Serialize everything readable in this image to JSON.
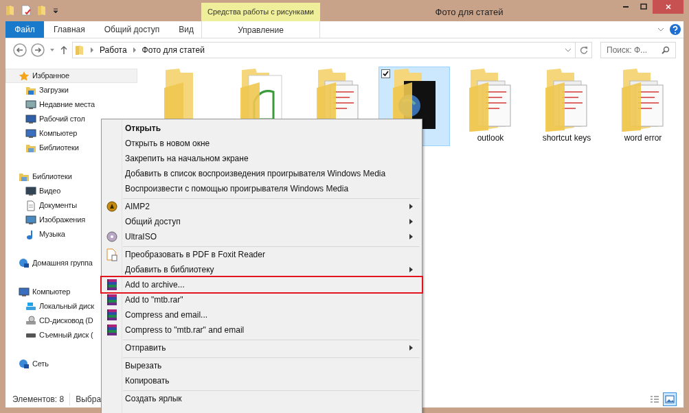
{
  "window": {
    "title": "Фото для статей",
    "context_tab": "Средства работы с рисунками"
  },
  "ribbon_tabs": [
    {
      "label": "Файл",
      "kind": "file"
    },
    {
      "label": "Главная",
      "kind": "tab"
    },
    {
      "label": "Общий доступ",
      "kind": "tab"
    },
    {
      "label": "Вид",
      "kind": "tab"
    },
    {
      "label": "Управление",
      "kind": "context"
    }
  ],
  "address": {
    "crumbs": [
      "Работа",
      "Фото для статей"
    ],
    "search_placeholder": "Поиск: Ф..."
  },
  "sidebar": [
    {
      "label": "Избранное",
      "kind": "star",
      "selected": true,
      "children": [
        {
          "label": "Загрузки",
          "kind": "downloads"
        },
        {
          "label": "Недавние места",
          "kind": "recent"
        },
        {
          "label": "Рабочий стол",
          "kind": "desktop"
        },
        {
          "label": "Компьютер",
          "kind": "computer"
        },
        {
          "label": "Библиотеки",
          "kind": "library"
        }
      ]
    },
    {
      "label": "Библиотеки",
      "kind": "library",
      "selected": false,
      "children": [
        {
          "label": "Видео",
          "kind": "video"
        },
        {
          "label": "Документы",
          "kind": "docs"
        },
        {
          "label": "Изображения",
          "kind": "images"
        },
        {
          "label": "Музыка",
          "kind": "music"
        }
      ]
    },
    {
      "label": "Домашняя группа",
      "kind": "homegroup",
      "selected": false
    },
    {
      "label": "Компьютер",
      "kind": "computer",
      "selected": false,
      "children": [
        {
          "label": "Локальный диск",
          "kind": "localdisk"
        },
        {
          "label": "CD-дисковод (D",
          "kind": "cd"
        },
        {
          "label": "Съемный диск (",
          "kind": "usb"
        }
      ]
    },
    {
      "label": "Сеть",
      "kind": "network",
      "selected": false
    }
  ],
  "files": [
    {
      "kind": "plain",
      "selected": false
    },
    {
      "kind": "paper",
      "selected": false
    },
    {
      "kind": "screens",
      "selected": false
    },
    {
      "kind": "dark",
      "selected": true
    },
    {
      "label": "outlook",
      "kind": "screens",
      "selected": false
    },
    {
      "label": "shortcut keys",
      "kind": "screens",
      "selected": false
    },
    {
      "label": "word error",
      "kind": "screens",
      "selected": false
    }
  ],
  "context_menu": [
    [
      {
        "label": "Открыть",
        "kind": "plain",
        "bold": true,
        "submenu": false,
        "highlighted": false
      },
      {
        "label": "Открыть в новом окне",
        "kind": "plain",
        "bold": false,
        "submenu": false,
        "highlighted": false
      },
      {
        "label": "Закрепить на начальном экране",
        "kind": "plain",
        "bold": false,
        "submenu": false,
        "highlighted": false
      },
      {
        "label": "Добавить в список воспроизведения проигрывателя Windows Media",
        "kind": "plain",
        "bold": false,
        "submenu": false,
        "highlighted": false
      },
      {
        "label": "Воспроизвести с помощью проигрывателя Windows Media",
        "kind": "plain",
        "bold": false,
        "submenu": false,
        "highlighted": false
      }
    ],
    [
      {
        "label": "AIMP2",
        "kind": "aimp",
        "bold": false,
        "submenu": true,
        "highlighted": false
      },
      {
        "label": "Общий доступ",
        "kind": "plain",
        "bold": false,
        "submenu": true,
        "highlighted": false
      },
      {
        "label": "UltraISO",
        "kind": "disc",
        "bold": false,
        "submenu": true,
        "highlighted": false
      }
    ],
    [
      {
        "label": "Преобразовать в PDF в Foxit Reader",
        "kind": "pdf",
        "bold": false,
        "submenu": false,
        "highlighted": false
      },
      {
        "label": "Добавить в библиотеку",
        "kind": "plain",
        "bold": false,
        "submenu": true,
        "highlighted": false
      },
      {
        "label": "Add to archive...",
        "kind": "rar",
        "bold": false,
        "submenu": false,
        "highlighted": true
      },
      {
        "label": "Add to \"mtb.rar\"",
        "kind": "rar",
        "bold": false,
        "submenu": false,
        "highlighted": false
      },
      {
        "label": "Compress and email...",
        "kind": "rar",
        "bold": false,
        "submenu": false,
        "highlighted": false
      },
      {
        "label": "Compress to \"mtb.rar\" and email",
        "kind": "rar",
        "bold": false,
        "submenu": false,
        "highlighted": false
      }
    ],
    [
      {
        "label": "Отправить",
        "kind": "plain",
        "bold": false,
        "submenu": true,
        "highlighted": false
      }
    ],
    [
      {
        "label": "Вырезать",
        "kind": "plain",
        "bold": false,
        "submenu": false,
        "highlighted": false
      },
      {
        "label": "Копировать",
        "kind": "plain",
        "bold": false,
        "submenu": false,
        "highlighted": false
      }
    ],
    [
      {
        "label": "Создать ярлык",
        "kind": "plain",
        "bold": false,
        "submenu": false,
        "highlighted": false
      }
    ]
  ],
  "status_bar": {
    "items_count": "Элементов: 8",
    "selected": "Выбра"
  },
  "view_buttons": [
    {
      "kind": "details",
      "selected": false
    },
    {
      "kind": "large",
      "selected": true
    }
  ]
}
